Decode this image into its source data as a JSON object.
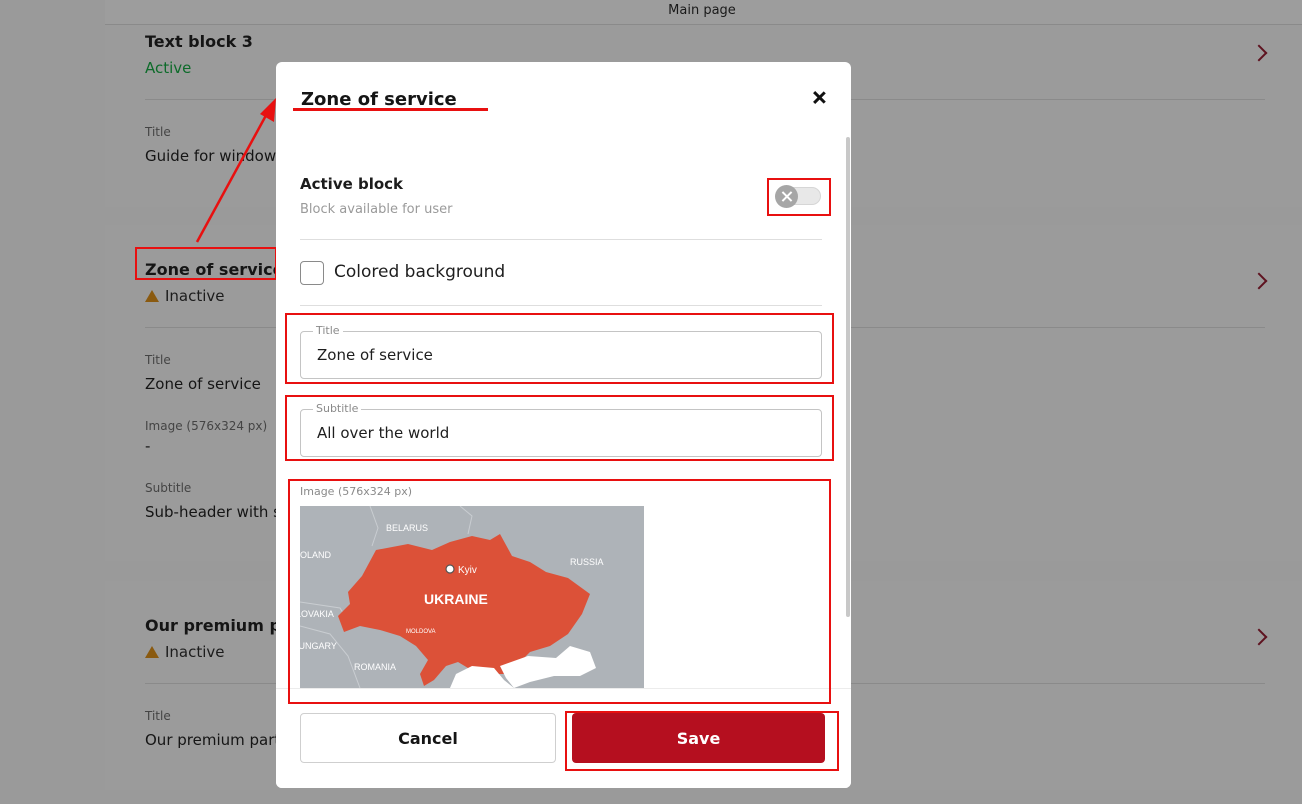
{
  "header": {
    "title": "Main page"
  },
  "cards": [
    {
      "title": "Text block 3",
      "status": "Active",
      "fields": [
        {
          "label": "Title",
          "value": "Guide for window"
        }
      ]
    },
    {
      "title": "Zone of service",
      "status": "Inactive",
      "fields": [
        {
          "label": "Title",
          "value": "Zone of service"
        },
        {
          "label": "Image (576x324 px)",
          "value": "-"
        },
        {
          "label": "Subtitle",
          "value": "Sub-header with s"
        }
      ]
    },
    {
      "title": "Our premium pa",
      "status": "Inactive",
      "fields": [
        {
          "label": "Title",
          "value": "Our premium partn"
        }
      ]
    }
  ],
  "modal": {
    "title": "Zone of service",
    "active_block": {
      "label": "Active block",
      "sublabel": "Block available for user",
      "enabled": false
    },
    "colored_background": {
      "label": "Colored background",
      "checked": false
    },
    "title_field": {
      "label": "Title",
      "value": "Zone of service"
    },
    "subtitle_field": {
      "label": "Subtitle",
      "value": "All over the world"
    },
    "image": {
      "label": "Image (576x324 px)",
      "map_labels": {
        "belarus": "BELARUS",
        "poland": "POLAND",
        "russia": "RUSSIA",
        "kyiv": "Kyiv",
        "ukraine": "UKRAINE",
        "slovakia": "SLOVAKIA",
        "moldova": "MOLDOVA",
        "hungary": "HUNGARY",
        "romania": "ROMANIA"
      }
    },
    "buttons": {
      "cancel": "Cancel",
      "save": "Save"
    }
  },
  "colors": {
    "accent": "#b50f1f",
    "annotation": "#e81010",
    "map_land": "#aeb3b8",
    "map_ukraine": "#dc5138",
    "active_status": "#0d6b2a"
  },
  "icons": [
    "close-icon",
    "toggle-off-icon",
    "chevron-right-icon",
    "warning-icon"
  ]
}
